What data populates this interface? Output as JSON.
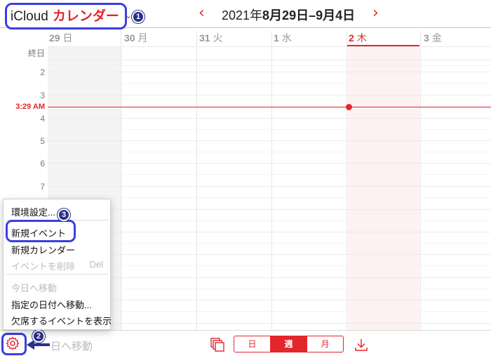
{
  "header": {
    "app_prefix": "iCloud",
    "app_name": "カレンダー",
    "chevron": "⌄",
    "prev": "‹",
    "next": "›",
    "year": "2021年",
    "range": "8月29日–9月4日"
  },
  "days": [
    {
      "num": "29",
      "name": "日"
    },
    {
      "num": "30",
      "name": "月"
    },
    {
      "num": "31",
      "name": "火"
    },
    {
      "num": "1",
      "name": "水"
    },
    {
      "num": "2",
      "name": "木"
    },
    {
      "num": "3",
      "name": "金"
    }
  ],
  "time_labels": [
    "終日",
    "2",
    "3",
    "4",
    "5",
    "6",
    "7"
  ],
  "now_label": "3:29 AM",
  "menu": {
    "items": [
      {
        "label": "環境設定...",
        "enabled": true
      },
      {
        "label": "新規イベント",
        "enabled": true
      },
      {
        "label": "新規カレンダー",
        "enabled": true
      },
      {
        "label": "イベントを削除",
        "enabled": false,
        "shortcut": "Del"
      },
      {
        "label": "今日へ移動",
        "enabled": false
      },
      {
        "label": "指定の日付へ移動...",
        "enabled": true
      },
      {
        "label": "欠席するイベントを表示",
        "enabled": true
      }
    ]
  },
  "toolbar": {
    "goto_today": "日へ移動",
    "views": [
      "日",
      "週",
      "月"
    ],
    "active_view": "週"
  },
  "callouts": [
    "1",
    "2",
    "3"
  ],
  "colors": {
    "accent": "#e3262b",
    "annotation": "#3b3fe0",
    "today_column": "#fdf1f1",
    "weekend_column": "#f4f4f4"
  }
}
